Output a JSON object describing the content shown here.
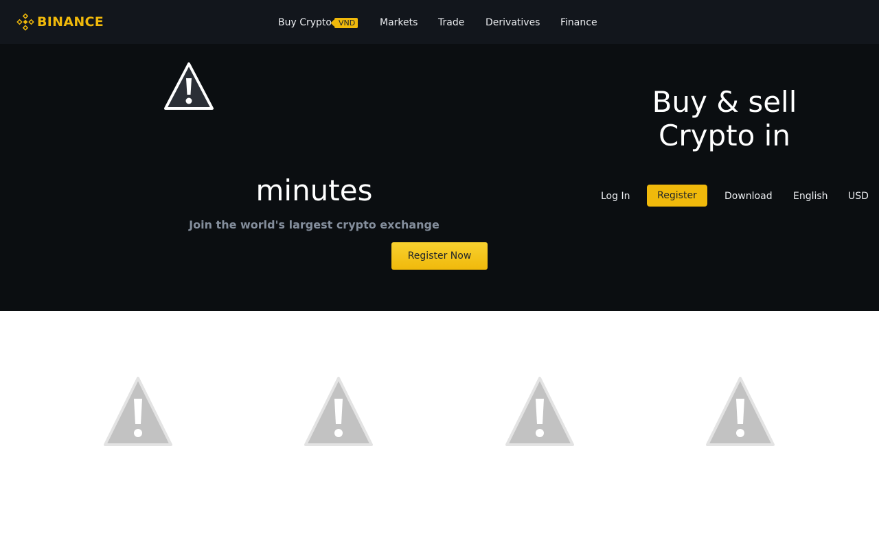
{
  "brand": {
    "name": "BINANCE",
    "color": "#f0b90b"
  },
  "nav": {
    "items": [
      {
        "label": "Buy Crypto",
        "badge": "VND"
      },
      {
        "label": "Markets"
      },
      {
        "label": "Trade"
      },
      {
        "label": "Derivatives"
      },
      {
        "label": "Finance"
      }
    ]
  },
  "hero": {
    "image_icon": "broken-image-icon",
    "title_line1": "Buy & sell",
    "title_line2": "Crypto in",
    "title_line3": "minutes",
    "subtitle": "Join the world's largest crypto exchange",
    "cta_label": "Register Now",
    "links": {
      "login": "Log In",
      "register": "Register",
      "download": "Download",
      "language": "English",
      "currency": "USD"
    }
  },
  "features": {
    "image_icons": [
      "broken-image-icon",
      "broken-image-icon",
      "broken-image-icon",
      "broken-image-icon"
    ]
  },
  "colors": {
    "topbar_bg": "#12161c",
    "hero_bg": "#0b0e11",
    "accent": "#f0b90b",
    "subtitle": "#848e9c"
  }
}
